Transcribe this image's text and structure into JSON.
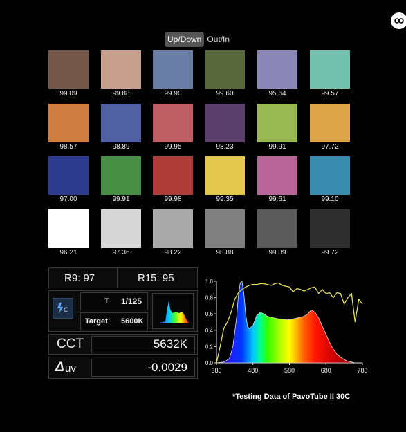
{
  "toggle": {
    "options": [
      "Up/Down",
      "Out/In"
    ],
    "active": "Up/Down"
  },
  "corner_icon": "link-icon",
  "swatches": [
    {
      "color": "#74574b",
      "value": "99.09"
    },
    {
      "color": "#c79f8e",
      "value": "99.88"
    },
    {
      "color": "#6a7ea6",
      "value": "99.90"
    },
    {
      "color": "#59683c",
      "value": "99.60"
    },
    {
      "color": "#8b88b8",
      "value": "95.64"
    },
    {
      "color": "#72c0ad",
      "value": "99.57"
    },
    {
      "color": "#cf7e42",
      "value": "98.57"
    },
    {
      "color": "#5060a2",
      "value": "98.89"
    },
    {
      "color": "#bf6067",
      "value": "99.95"
    },
    {
      "color": "#593f69",
      "value": "98.23"
    },
    {
      "color": "#9ab953",
      "value": "99.91"
    },
    {
      "color": "#dca54a",
      "value": "97.72"
    },
    {
      "color": "#2e3c8f",
      "value": "97.00"
    },
    {
      "color": "#478f45",
      "value": "99.91"
    },
    {
      "color": "#ae3d3a",
      "value": "99.98"
    },
    {
      "color": "#e3c64d",
      "value": "99.35"
    },
    {
      "color": "#b76597",
      "value": "99.61"
    },
    {
      "color": "#3a8bb0",
      "value": "99.10"
    },
    {
      "color": "#ffffff",
      "value": "96.21"
    },
    {
      "color": "#d6d6d6",
      "value": "97.36"
    },
    {
      "color": "#aaaaaa",
      "value": "98.22"
    },
    {
      "color": "#808080",
      "value": "98.88"
    },
    {
      "color": "#5a5a5a",
      "value": "99.39"
    },
    {
      "color": "#2e2e2e",
      "value": "99.72"
    }
  ],
  "readings": {
    "r9": "R9: 97",
    "r15": "R15: 95",
    "mode_icon": "flash-c-icon",
    "t_label": "T",
    "t_value": "1/125",
    "target_label": "Target",
    "target_value": "5600K",
    "spectrum_thumb_icon": "spectrum-thumbnail-icon",
    "cct_label": "CCT",
    "cct_value": "5632K",
    "duv_label": "uv",
    "duv_value": "-0.0029"
  },
  "chart_data": {
    "type": "area",
    "xlim": [
      380,
      780
    ],
    "ylim": [
      0,
      1.0
    ],
    "x_ticks": [
      380,
      480,
      580,
      680,
      780
    ],
    "y_ticks": [
      0.0,
      0.2,
      0.4,
      0.6,
      0.8,
      1.0
    ],
    "x_tick_labels": [
      "380",
      "480",
      "580",
      "680",
      "780"
    ],
    "y_tick_labels": [
      "0.0",
      "0.2",
      "0.4",
      "0.6",
      "0.8",
      "1.0"
    ],
    "grid": false,
    "series": [
      {
        "kind": "spectrum",
        "x": [
          380,
          400,
          415,
          425,
          435,
          440,
          445,
          450,
          455,
          460,
          465,
          470,
          480,
          490,
          500,
          510,
          520,
          530,
          540,
          550,
          560,
          570,
          580,
          590,
          600,
          610,
          620,
          630,
          640,
          650,
          660,
          670,
          680,
          690,
          700,
          710,
          720,
          730,
          740,
          750,
          760,
          780
        ],
        "y": [
          0.0,
          0.01,
          0.05,
          0.2,
          0.55,
          0.82,
          0.98,
          1.0,
          0.85,
          0.6,
          0.45,
          0.42,
          0.46,
          0.58,
          0.62,
          0.6,
          0.57,
          0.56,
          0.55,
          0.54,
          0.54,
          0.53,
          0.53,
          0.54,
          0.55,
          0.56,
          0.57,
          0.6,
          0.65,
          0.62,
          0.55,
          0.45,
          0.35,
          0.25,
          0.17,
          0.11,
          0.07,
          0.04,
          0.02,
          0.01,
          0.0,
          0.0
        ]
      },
      {
        "kind": "ratio-line",
        "color": "#e7df57",
        "x": [
          380,
          390,
          400,
          410,
          420,
          430,
          440,
          450,
          460,
          470,
          480,
          490,
          500,
          510,
          520,
          530,
          540,
          550,
          560,
          570,
          580,
          590,
          600,
          610,
          620,
          630,
          640,
          650,
          660,
          670,
          680,
          690,
          700,
          710,
          720,
          730,
          740,
          750,
          760,
          770,
          780
        ],
        "y": [
          0.0,
          0.2,
          0.42,
          0.5,
          0.62,
          0.78,
          0.86,
          0.9,
          0.93,
          0.95,
          0.96,
          0.96,
          0.97,
          0.97,
          0.96,
          0.95,
          0.97,
          0.98,
          0.95,
          0.94,
          0.93,
          0.87,
          0.91,
          0.9,
          0.88,
          0.9,
          0.92,
          0.93,
          0.85,
          0.9,
          0.85,
          0.86,
          0.8,
          0.86,
          0.85,
          0.72,
          0.8,
          0.85,
          0.5,
          0.78,
          0.72
        ]
      }
    ]
  },
  "footnote": "*Testing Data of PavoTube II 30C"
}
